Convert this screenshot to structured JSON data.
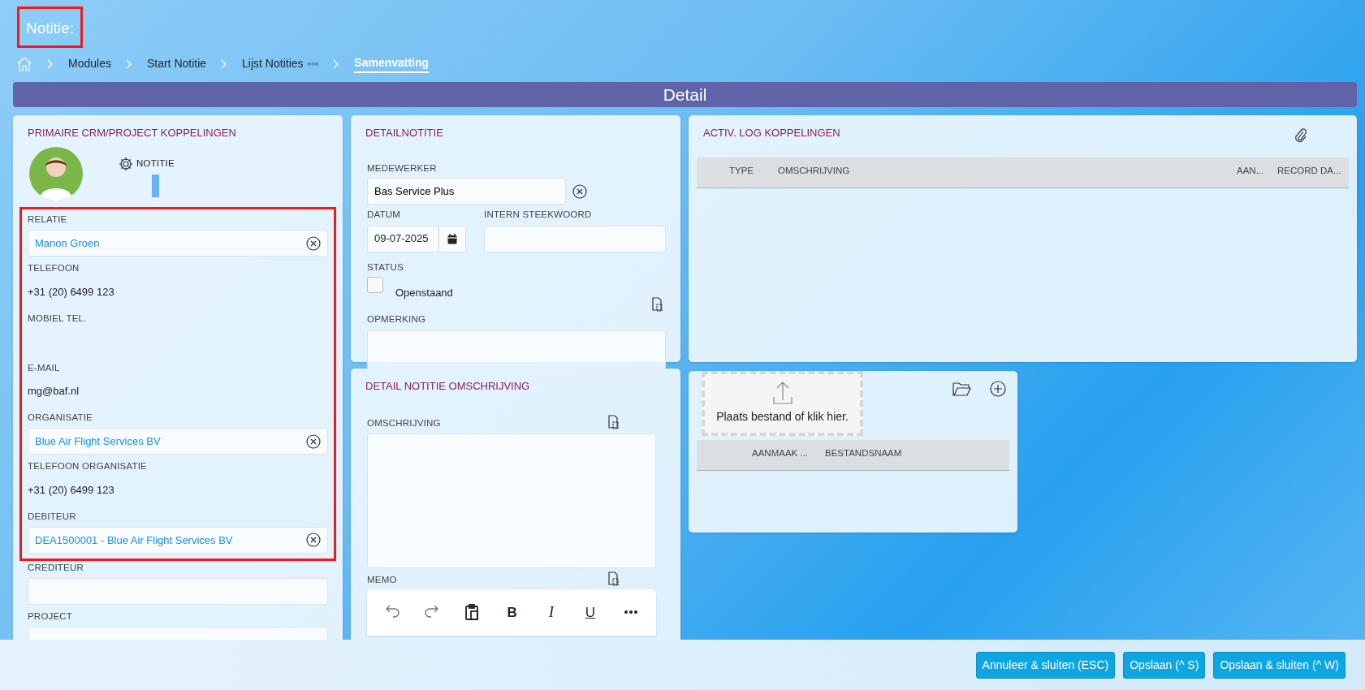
{
  "header": {
    "title": "Notitie:",
    "highlighted": true
  },
  "breadcrumb": [
    {
      "label": "Modules",
      "current": false
    },
    {
      "label": "Start Notitie",
      "current": false
    },
    {
      "label": "Lijst Notities ◦◦◦",
      "current": false
    },
    {
      "label": "Samenvatting",
      "current": true
    }
  ],
  "detail_bar": {
    "title": "Detail"
  },
  "primary_panel": {
    "title": "PRIMAIRE CRM/PROJECT KOPPELINGEN",
    "tab": {
      "label": "NOTITIE",
      "selected": true
    },
    "highlighted_fields": [
      {
        "kind": "lookup",
        "label": "RELATIE",
        "value": "Manon Groen"
      },
      {
        "kind": "text",
        "label": "TELEFOON",
        "value": "+31 (20) 6499 123"
      },
      {
        "kind": "text",
        "label": "MOBIEL TEL."
      },
      {
        "kind": "text",
        "label": "E-MAIL",
        "value": "mg@baf.nl"
      },
      {
        "kind": "lookup",
        "label": "ORGANISATIE",
        "value": "Blue Air Flight Services BV"
      },
      {
        "kind": "text",
        "label": "TELEFOON ORGANISATIE",
        "value": "+31 (20) 6499 123"
      },
      {
        "kind": "lookup",
        "label": "DEBITEUR",
        "value": "DEA1500001 - Blue Air Flight Services BV"
      }
    ],
    "fields": [
      {
        "kind": "input",
        "label": "CREDITEUR"
      },
      {
        "kind": "input",
        "label": "PROJECT"
      }
    ]
  },
  "detail_panel": {
    "title": "DETAILNOTITIE",
    "employee": {
      "label": "MEDEWERKER",
      "value": "Bas Service Plus"
    },
    "date": {
      "label": "DATUM",
      "value": "09-07-2025"
    },
    "keyword": {
      "label": "INTERN STEEKWOORD"
    },
    "status": {
      "label": "STATUS",
      "option": "Openstaand",
      "checked": false
    },
    "remark": {
      "label": "OPMERKING"
    }
  },
  "description_panel": {
    "title": "DETAIL NOTITIE OMSCHRIJVING",
    "description": {
      "label": "OMSCHRIJVING"
    },
    "memo": {
      "label": "MEMO",
      "toolbar": [
        {
          "kind": "undo"
        },
        {
          "kind": "redo"
        },
        {
          "kind": "paste"
        },
        {
          "kind": "bold",
          "label": "B"
        },
        {
          "kind": "italic",
          "label": "I"
        },
        {
          "kind": "underline",
          "label": "U"
        },
        {
          "kind": "more"
        }
      ]
    }
  },
  "activity_panel": {
    "title": "ACTIV. LOG KOPPELINGEN",
    "columns": [
      "TYPE",
      "OMSCHRIJVING",
      "AAN...",
      "RECORD DA..."
    ]
  },
  "attachments_panel": {
    "dropzone": "Plaats bestand of klik hier.",
    "columns": [
      "AANMAAK ...",
      "BESTANDSNAAM"
    ]
  },
  "buttons": [
    "Annuleer & sluiten (ESC)",
    "Opslaan (^ S)",
    "Opslaan & sluiten (^ W)"
  ]
}
